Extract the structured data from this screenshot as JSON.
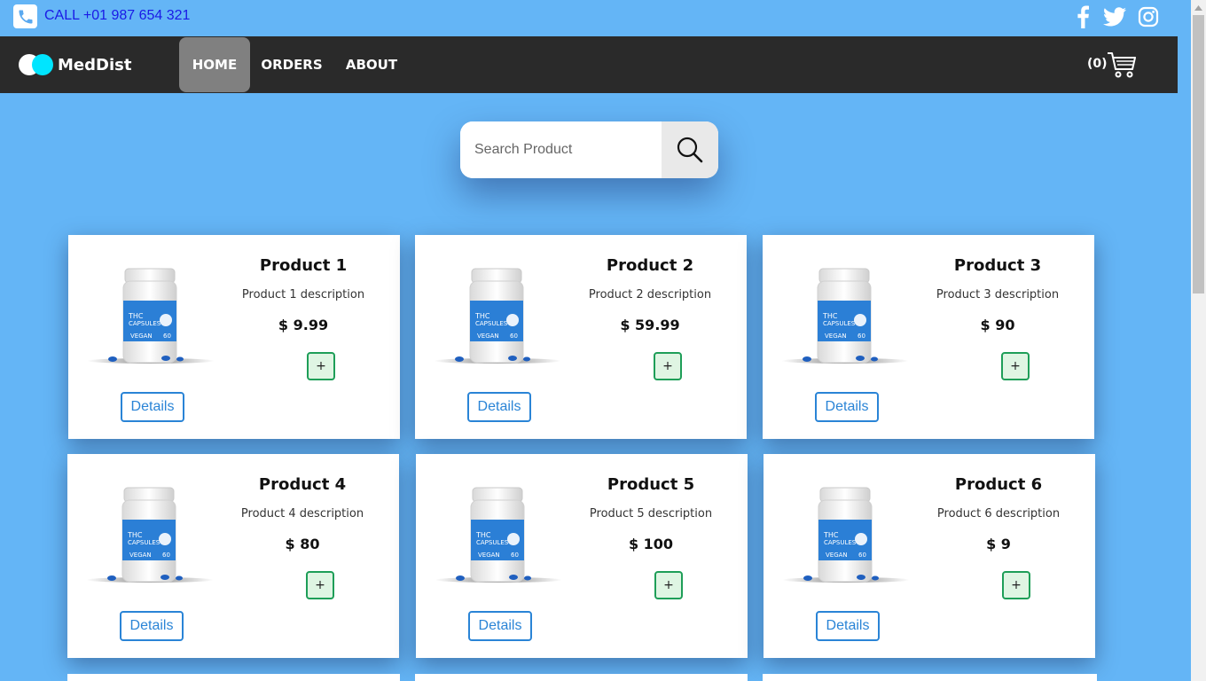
{
  "topbar": {
    "call_text": "CALL +01 987 654 321",
    "social_icons": [
      "facebook-icon",
      "twitter-icon",
      "instagram-icon"
    ]
  },
  "navbar": {
    "brand": "MedDist",
    "items": [
      {
        "label": "HOME",
        "active": true
      },
      {
        "label": "ORDERS",
        "active": false
      },
      {
        "label": "ABOUT",
        "active": false
      }
    ],
    "cart_count": "(0)"
  },
  "search": {
    "placeholder": "Search Product"
  },
  "products": [
    {
      "title": "Product 1",
      "description": "Product 1 description",
      "price": "$ 9.99",
      "add_label": "+",
      "details_label": "Details"
    },
    {
      "title": "Product 2",
      "description": "Product 2 description",
      "price": "$ 59.99",
      "add_label": "+",
      "details_label": "Details"
    },
    {
      "title": "Product 3",
      "description": "Product 3 description",
      "price": "$ 90",
      "add_label": "+",
      "details_label": "Details"
    },
    {
      "title": "Product 4",
      "description": "Product 4 description",
      "price": "$ 80",
      "add_label": "+",
      "details_label": "Details"
    },
    {
      "title": "Product 5",
      "description": "Product 5 description",
      "price": "$ 100",
      "add_label": "+",
      "details_label": "Details"
    },
    {
      "title": "Product 6",
      "description": "Product 6 description",
      "price": "$ 9",
      "add_label": "+",
      "details_label": "Details"
    }
  ],
  "product_label": {
    "line1": "THC",
    "line2": "CAPSULES",
    "badge": "VEGAN",
    "count": "60"
  },
  "colors": {
    "background": "#64b5f6",
    "navbar": "#2a2a2a",
    "active_nav": "#808080",
    "details_accent": "#2a84d6",
    "add_accent": "#1e9e58",
    "call_text": "#1a1ae6"
  }
}
